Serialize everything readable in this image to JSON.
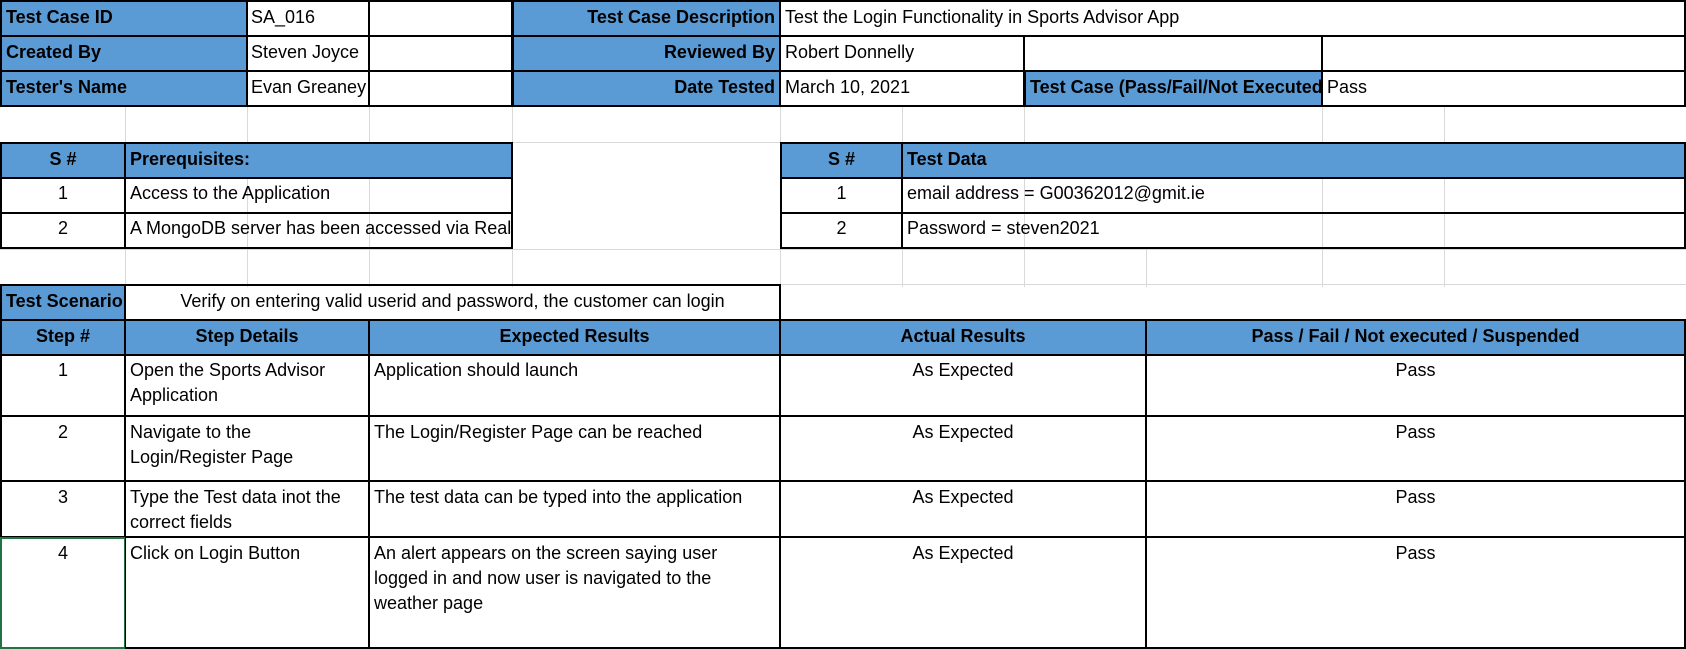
{
  "header": {
    "id_label": "Test Case ID",
    "id_value": "SA_016",
    "desc_label": "Test Case Description",
    "desc_value": "Test the Login Functionality in Sports Advisor App",
    "created_label": "Created By",
    "created_value": "Steven Joyce",
    "reviewed_label": "Reviewed By",
    "reviewed_value": "Robert Donnelly",
    "tester_label": "Tester's Name",
    "tester_value": "Evan Greaney",
    "date_label": "Date Tested",
    "date_value": "March 10, 2021",
    "result_label": "Test Case (Pass/Fail/Not Executed)",
    "result_value": "Pass"
  },
  "prereq": {
    "sn_label": "S #",
    "title": "Prerequisites:",
    "items": [
      {
        "n": "1",
        "text": "Access to the Application"
      },
      {
        "n": "2",
        "text": "A MongoDB server has been accessed via Realm"
      }
    ]
  },
  "testdata": {
    "sn_label": "S #",
    "title": "Test Data",
    "items": [
      {
        "n": "1",
        "text": "email address = G00362012@gmit.ie"
      },
      {
        "n": "2",
        "text": "Password = steven2021"
      }
    ]
  },
  "scenario": {
    "label": "Test Scenario",
    "text": "Verify on entering valid userid and password, the customer can login"
  },
  "steps": {
    "headers": [
      "Step #",
      "Step Details",
      "Expected Results",
      "Actual Results",
      "Pass / Fail / Not executed / Suspended"
    ],
    "rows": [
      {
        "n": "1",
        "details": "Open the Sports Advisor Application",
        "expected": "Application should launch",
        "actual": "As Expected",
        "status": "Pass"
      },
      {
        "n": "2",
        "details": "Navigate to the Login/Register Page",
        "expected": "The Login/Register Page can be reached",
        "actual": "As Expected",
        "status": "Pass"
      },
      {
        "n": "3",
        "details": "Type the Test data inot the correct fields",
        "expected": "The test data can be typed into the application",
        "actual": "As Expected",
        "status": "Pass"
      },
      {
        "n": "4",
        "details": "Click on Login Button",
        "expected": "An alert appears on the screen saying user logged in and now user is navigated to the weather page",
        "actual": "As Expected",
        "status": "Pass"
      }
    ]
  }
}
